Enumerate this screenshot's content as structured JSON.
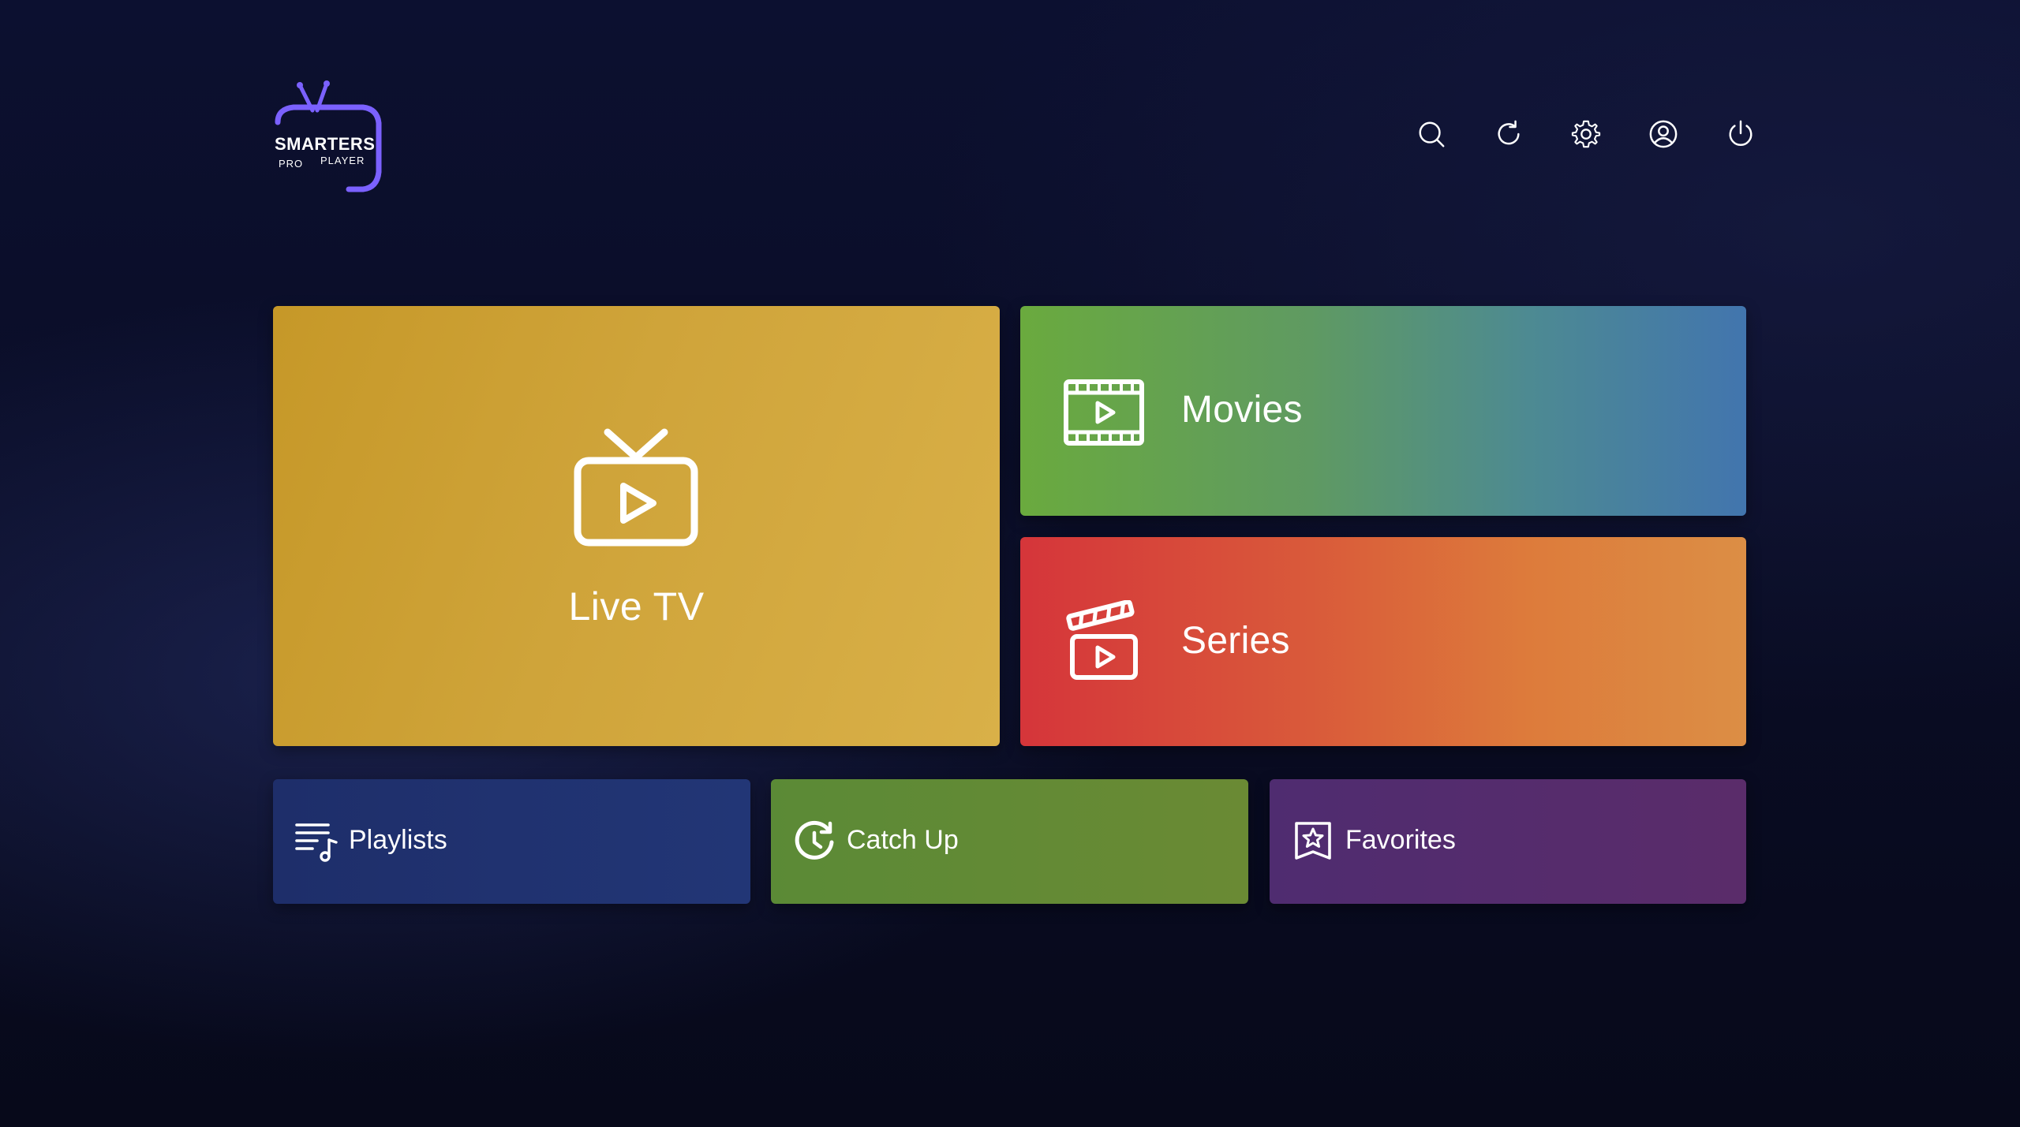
{
  "logo": {
    "title": "SMARTERS",
    "sub_left": "PRO",
    "sub_right": "PLAYER",
    "accent_color": "#7b61ff"
  },
  "top_actions": [
    {
      "name": "search",
      "icon": "search-icon"
    },
    {
      "name": "refresh",
      "icon": "refresh-icon"
    },
    {
      "name": "settings",
      "icon": "gear-icon"
    },
    {
      "name": "profile",
      "icon": "user-circle-icon"
    },
    {
      "name": "power",
      "icon": "power-icon"
    }
  ],
  "tiles": {
    "live_tv": {
      "label": "Live TV",
      "icon": "tv-play-icon",
      "color": "#cfa43a"
    },
    "movies": {
      "label": "Movies",
      "icon": "film-play-icon",
      "color_start": "#6aaa3e",
      "color_end": "#4275ae"
    },
    "series": {
      "label": "Series",
      "icon": "clapperboard-icon",
      "color_start": "#d5353a",
      "color_end": "#dc8e45"
    },
    "playlists": {
      "label": "Playlists",
      "icon": "playlist-music-icon",
      "color": "#1e2e6a"
    },
    "catch_up": {
      "label": "Catch Up",
      "icon": "catch-up-icon",
      "color": "#5b8a36"
    },
    "favorites": {
      "label": "Favorites",
      "icon": "star-badge-icon",
      "color": "#4f2c70"
    }
  }
}
